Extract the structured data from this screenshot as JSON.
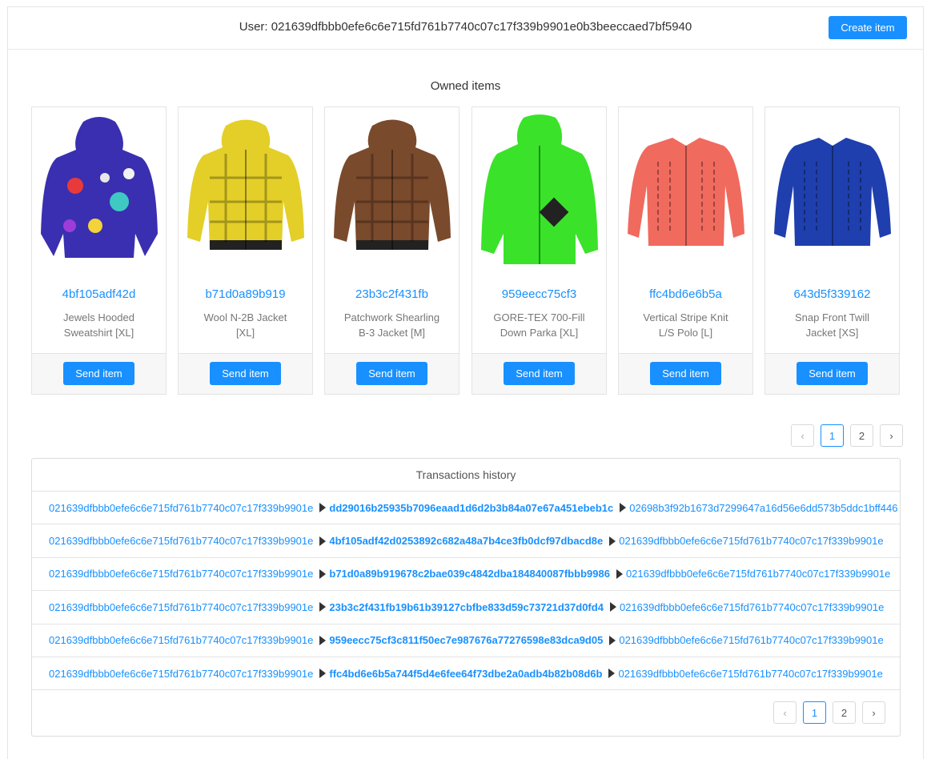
{
  "header": {
    "user_label": "User: 021639dfbbb0efe6c6e715fd761b7740c07c17f339b9901e0b3beeccaed7bf5940",
    "create_button": "Create item"
  },
  "owned": {
    "title": "Owned items",
    "send_label": "Send item",
    "items": [
      {
        "id": "4bf105adf42d",
        "name": "Jewels Hooded Sweatshirt [XL]",
        "color": "#3a2fb0",
        "kind": "hoodie"
      },
      {
        "id": "b71d0a89b919",
        "name": "Wool N-2B Jacket [XL]",
        "color": "#e3cf28",
        "kind": "jacket"
      },
      {
        "id": "23b3c2f431fb",
        "name": "Patchwork Shearling B-3 Jacket [M]",
        "color": "#7a4a2c",
        "kind": "jacket"
      },
      {
        "id": "959eecc75cf3",
        "name": "GORE-TEX 700-Fill Down Parka [XL]",
        "color": "#3be22a",
        "kind": "parka"
      },
      {
        "id": "ffc4bd6e6b5a",
        "name": "Vertical Stripe Knit L/S Polo [L]",
        "color": "#f06a5e",
        "kind": "shirt"
      },
      {
        "id": "643d5f339162",
        "name": "Snap Front Twill Jacket [XS]",
        "color": "#1f3fae",
        "kind": "shirt"
      }
    ],
    "pagination": {
      "pages": [
        "1",
        "2"
      ],
      "active": "1"
    }
  },
  "transactions": {
    "title": "Transactions history",
    "rows": [
      {
        "from": "021639dfbbb0efe6c6e715fd761b7740c07c17f339b9901e",
        "item": "dd29016b25935b7096eaad1d6d2b3b84a07e67a451ebeb1c",
        "to": "02698b3f92b1673d7299647a16d56e6dd573b5ddc1bff446"
      },
      {
        "from": "021639dfbbb0efe6c6e715fd761b7740c07c17f339b9901e",
        "item": "4bf105adf42d0253892c682a48a7b4ce3fb0dcf97dbacd8e",
        "to": "021639dfbbb0efe6c6e715fd761b7740c07c17f339b9901e"
      },
      {
        "from": "021639dfbbb0efe6c6e715fd761b7740c07c17f339b9901e",
        "item": "b71d0a89b919678c2bae039c4842dba184840087fbbb9986",
        "to": "021639dfbbb0efe6c6e715fd761b7740c07c17f339b9901e"
      },
      {
        "from": "021639dfbbb0efe6c6e715fd761b7740c07c17f339b9901e",
        "item": "23b3c2f431fb19b61b39127cbfbe833d59c73721d37d0fd4",
        "to": "021639dfbbb0efe6c6e715fd761b7740c07c17f339b9901e"
      },
      {
        "from": "021639dfbbb0efe6c6e715fd761b7740c07c17f339b9901e",
        "item": "959eecc75cf3c811f50ec7e987676a77276598e83dca9d05",
        "to": "021639dfbbb0efe6c6e715fd761b7740c07c17f339b9901e"
      },
      {
        "from": "021639dfbbb0efe6c6e715fd761b7740c07c17f339b9901e",
        "item": "ffc4bd6e6b5a744f5d4e6fee64f73dbe2a0adb4b82b08d6b",
        "to": "021639dfbbb0efe6c6e715fd761b7740c07c17f339b9901e"
      }
    ],
    "pagination": {
      "pages": [
        "1",
        "2"
      ],
      "active": "1"
    }
  }
}
